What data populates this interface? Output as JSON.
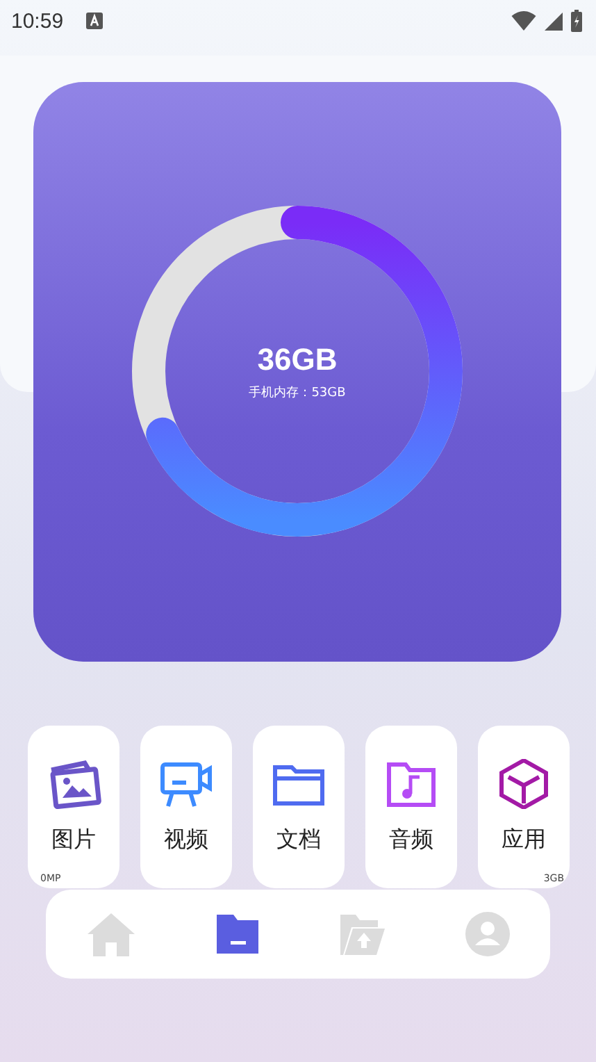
{
  "status_bar": {
    "time": "10:59"
  },
  "storage": {
    "used": "36GB",
    "caption": "手机内存：53GB",
    "level": 0.68
  },
  "categories": [
    {
      "kind": "image",
      "label": "图片",
      "note": "0MP"
    },
    {
      "kind": "video",
      "label": "视频"
    },
    {
      "kind": "doc",
      "label": "文档"
    },
    {
      "kind": "audio",
      "label": "音频"
    },
    {
      "kind": "app",
      "label": "应用",
      "note": "3GB"
    }
  ],
  "nav": [
    {
      "kind": "home",
      "selected": false
    },
    {
      "kind": "files",
      "selected": true
    },
    {
      "kind": "upload",
      "selected": false
    },
    {
      "kind": "profile",
      "selected": false
    }
  ]
}
